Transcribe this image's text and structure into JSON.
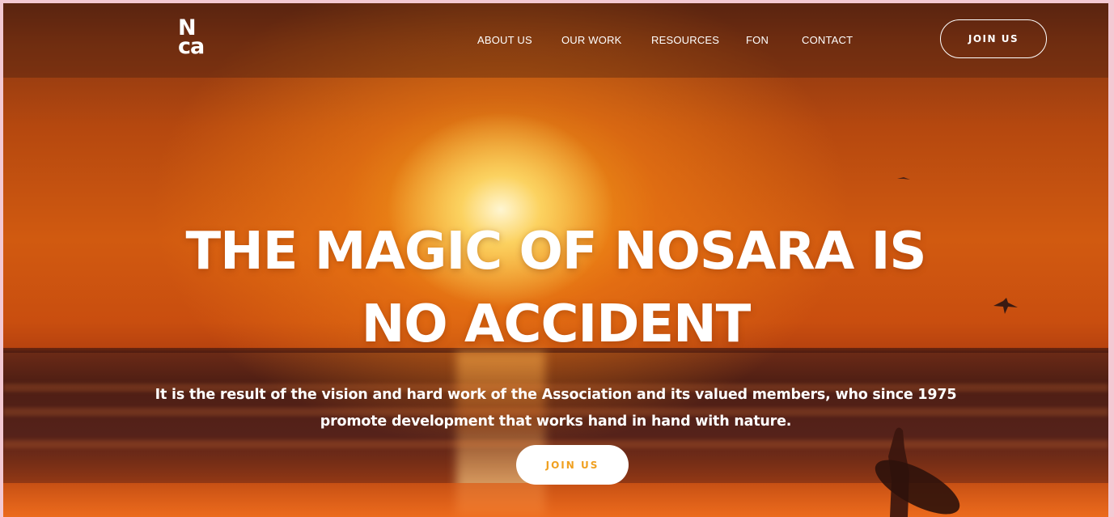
{
  "header": {
    "logo_line1": "N",
    "logo_line2": "ca",
    "nav": [
      {
        "label": "ABOUT US"
      },
      {
        "label": "OUR WORK"
      },
      {
        "label": "RESOURCES"
      },
      {
        "label": "FON"
      },
      {
        "label": "CONTACT"
      }
    ],
    "join_label": "JOIN US"
  },
  "hero": {
    "headline_line1": "THE MAGIC OF NOSARA IS",
    "headline_line2": "NO ACCIDENT",
    "subtext_line1": "It is the result of the vision and hard work of the Association and its valued members, who since 1975",
    "subtext_line2": "promote development that works hand in hand with nature.",
    "cta_label": "JOIN US"
  },
  "colors": {
    "cta_text": "#f0a020",
    "page_border": "#f3c9d3"
  }
}
